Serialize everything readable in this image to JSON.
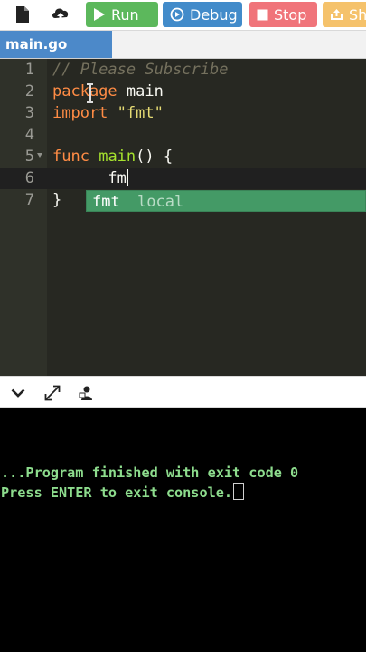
{
  "toolbar": {
    "icons": [
      "file-icon",
      "upload-icon"
    ],
    "run_label": "Run",
    "debug_label": "Debug",
    "stop_label": "Stop",
    "share_label": "Sh",
    "colors": {
      "run": "#5cb85c",
      "debug": "#428bca",
      "stop": "#f0747a",
      "share": "#f5c26b"
    }
  },
  "tabs": [
    {
      "label": "main.go"
    }
  ],
  "editor": {
    "lines": [
      {
        "num": "1",
        "text": "// Please Subscribe"
      },
      {
        "num": "2",
        "kw": "package",
        "rest": " main"
      },
      {
        "num": "3",
        "kw": "import",
        "str": "\"fmt\""
      },
      {
        "num": "4"
      },
      {
        "num": "5",
        "kw": "func",
        "fn": "main",
        "rest": "() {"
      },
      {
        "num": "6",
        "typed": "fm"
      },
      {
        "num": "7",
        "text": "}"
      }
    ]
  },
  "autocomplete": {
    "name": "fmt",
    "meta": "local"
  },
  "console": {
    "lines": [
      "...Program finished with exit code 0",
      "Press ENTER to exit console."
    ]
  }
}
